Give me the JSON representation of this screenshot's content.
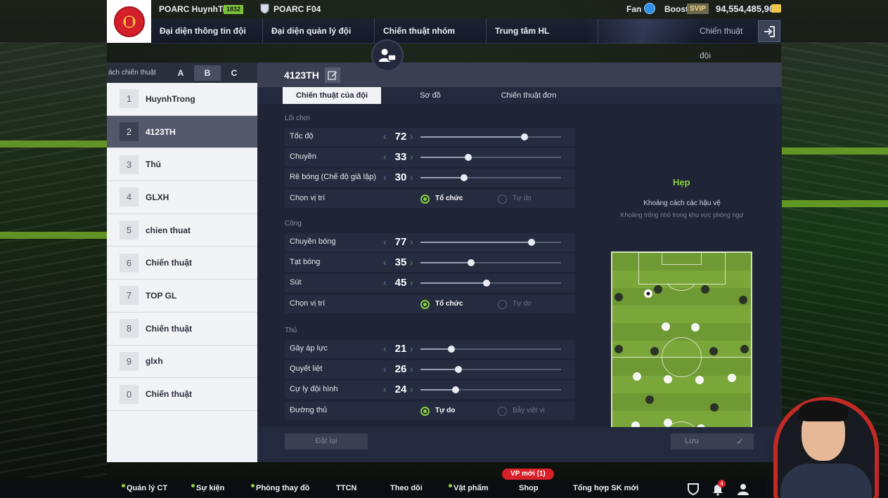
{
  "header": {
    "manager_name": "POARC HuynhTrong",
    "level": "1832",
    "team_name": "POARC F04",
    "fan_label": "Fan",
    "boost_label": "Boost",
    "svip_label": "SVIP",
    "coins": "94,554,485,902"
  },
  "nav": {
    "items": [
      "Đại diện thông tin đội",
      "Đại diện quản lý đội",
      "Chiến thuật nhóm",
      "Trung tâm HL"
    ],
    "right_label": "Chiến thuật đội"
  },
  "tactic_list": {
    "header_label": "ách chiến thuật",
    "tabs": [
      "A",
      "B",
      "C"
    ],
    "active_tab": "B",
    "items": [
      {
        "num": "1",
        "name": "HuynhTrong"
      },
      {
        "num": "2",
        "name": "4123TH"
      },
      {
        "num": "3",
        "name": "Thủ"
      },
      {
        "num": "4",
        "name": "GLXH"
      },
      {
        "num": "5",
        "name": "chien thuat"
      },
      {
        "num": "6",
        "name": "Chiến thuật"
      },
      {
        "num": "7",
        "name": "TOP GL"
      },
      {
        "num": "8",
        "name": "Chiến thuật"
      },
      {
        "num": "9",
        "name": "glxh"
      },
      {
        "num": "0",
        "name": "Chiến thuật"
      }
    ],
    "active_index": 1
  },
  "main": {
    "title": "4123TH",
    "subtabs": [
      "Chiến thuật của đội",
      "Sơ đồ",
      "Chiến thuật đơn"
    ],
    "active_subtab": 0,
    "sections": {
      "play_style": {
        "title": "Lối chơi",
        "sliders": [
          {
            "label": "Tốc độ",
            "value": "72",
            "fraction": 0.74
          },
          {
            "label": "Chuyền",
            "value": "33",
            "fraction": 0.34
          },
          {
            "label": "Rê bóng (Chế độ giả lập)",
            "value": "30",
            "fraction": 0.31
          }
        ],
        "positioning": {
          "label": "Chọn vị trí",
          "option_on": "Tổ chức",
          "option_off": "Tự do"
        }
      },
      "attack": {
        "title": "Công",
        "sliders": [
          {
            "label": "Chuyền bóng",
            "value": "77",
            "fraction": 0.79
          },
          {
            "label": "Tạt bóng",
            "value": "35",
            "fraction": 0.36
          },
          {
            "label": "Sút",
            "value": "45",
            "fraction": 0.47
          }
        ],
        "positioning": {
          "label": "Chọn vị trí",
          "option_on": "Tổ chức",
          "option_off": "Tự do"
        }
      },
      "defense": {
        "title": "Thủ",
        "sliders": [
          {
            "label": "Gây áp lực",
            "value": "21",
            "fraction": 0.22
          },
          {
            "label": "Quyết liệt",
            "value": "26",
            "fraction": 0.27
          },
          {
            "label": "Cự ly đội hình",
            "value": "24",
            "fraction": 0.25
          }
        ],
        "line": {
          "label": "Đường thủ",
          "option_on": "Tự do",
          "option_off": "Bẫy việt vị"
        }
      }
    },
    "description": {
      "title": "Hẹp",
      "line1": "Khoảng cách các hậu vệ",
      "line2": "Khoảng trống nhỏ trong khu vực phòng ngự"
    },
    "reset_label": "Đặt lại",
    "save_label": "Lưu"
  },
  "bottom_nav": {
    "items": [
      "Quản lý CT",
      "Sự kiện",
      "Phòng thay đồ",
      "TTCN",
      "Theo dõi",
      "Vật phẩm",
      "Shop",
      "Tổng hợp SK mới"
    ],
    "vp_badge": "VP mới (1)",
    "notification_count": "4"
  },
  "colors": {
    "accent_green": "#8ad13b",
    "panel_dark": "#1f2437",
    "list_light": "#f2f3f6",
    "badge_red": "#d8202a"
  },
  "icons": [
    "club-crest-icon",
    "team-shield-icon",
    "fan-icon",
    "coin-icon",
    "exit-icon",
    "chat-icon",
    "edit-icon",
    "soccer-ball-icon",
    "shield-icon",
    "bell-icon",
    "profile-icon",
    "check-icon"
  ]
}
